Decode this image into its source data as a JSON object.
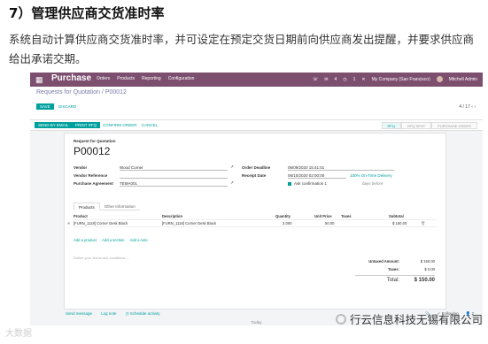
{
  "article": {
    "heading": "7）管理供应商交货准时率",
    "paragraph": "系统自动计算供应商交货准时率，并可设定在预定交货日期前向供应商发出提醒，并要求供应商给出承诺交期。"
  },
  "topbar": {
    "apps_icon": "grid-icon",
    "app_name": "Purchase",
    "nav": [
      "Orders",
      "Products",
      "Reporting",
      "Configuration"
    ],
    "chat_count": "4",
    "activity_count": "1",
    "company": "My Company (San Francisco)",
    "user": "Mitchell Admin",
    "brand_color": "#7c4f6f"
  },
  "control_panel": {
    "breadcrumb": "Requests for Quotation / P00012",
    "save_label": "SAVE",
    "discard_label": "DISCARD",
    "pager": "4 / 17",
    "accent_color": "#00a09d"
  },
  "action_bar": {
    "buttons": [
      "SEND BY EMAIL",
      "PRINT RFQ",
      "CONFIRM ORDER",
      "CANCEL"
    ],
    "stages": [
      "RFQ",
      "RFQ SENT",
      "PURCHASE ORDER"
    ],
    "active_stage": "RFQ"
  },
  "form": {
    "doc_type": "Request for Quotation",
    "po_number": "P00012",
    "vendor_label": "Vendor",
    "vendor_value": "Wood Corner",
    "vendor_ref_label": "Vendor Reference",
    "purchase_agreement_label": "Purchase Agreement",
    "purchase_agreement_value": "TEMA001",
    "order_deadline_label": "Order Deadline",
    "order_deadline_value": "06/09/2020 15:41:01",
    "receipt_date_label": "Receipt Date",
    "receipt_date_value": "06/10/2020 02:00:00",
    "on_time_label": "100% On-Time Delivery",
    "ask_confirmation_label": "Ask confirmation 1",
    "days_before_label": "days before"
  },
  "tabs": [
    "Products",
    "Other Information"
  ],
  "table": {
    "headers": [
      "Product",
      "Description",
      "Quantity",
      "Unit Price",
      "Taxes",
      "Subtotal"
    ],
    "rows": [
      {
        "product": "[FURN_1118] Corner Desk Black",
        "description": "[FURN_1118] Corner Desk Black",
        "quantity": "3.000",
        "unit_price": "50.00",
        "taxes": "",
        "subtotal": "$ 150.00"
      }
    ],
    "add_links": [
      "Add a product",
      "Add a section",
      "Add a note"
    ]
  },
  "notes_placeholder": "Define your terms and conditions ...",
  "totals": {
    "untaxed_label": "Untaxed Amount:",
    "untaxed_value": "$ 150.00",
    "taxes_label": "Taxes:",
    "taxes_value": "$ 0.00",
    "total_label": "Total:",
    "total_value": "$ 150.00"
  },
  "chatter": {
    "links": [
      "Send message",
      "Log note",
      "Schedule activity"
    ],
    "following_label": "Following",
    "followers_count": "2",
    "today_label": "Today"
  },
  "watermarks": {
    "left": "大数据",
    "brand_name": "行云信息科技无锡有限公司"
  }
}
